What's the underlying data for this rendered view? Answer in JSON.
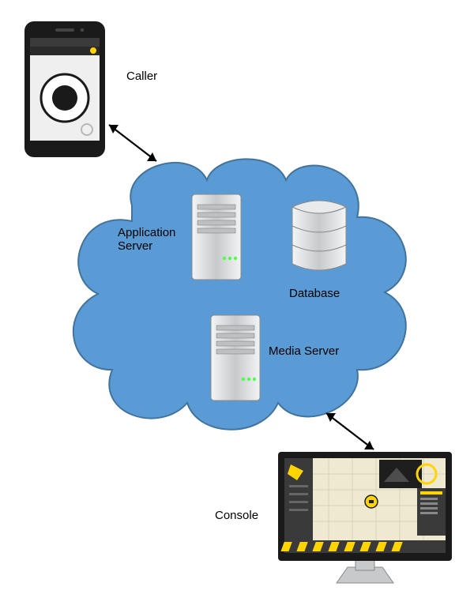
{
  "labels": {
    "caller": "Caller",
    "app_server_line1": "Application",
    "app_server_line2": "Server",
    "database": "Database",
    "media_server": "Media Server",
    "console": "Console"
  },
  "nodes": {
    "phone": "mobile-handset",
    "cloud": "cloud-background",
    "app_server": "tower-server",
    "media_server": "tower-server",
    "database": "database-cylinder",
    "console": "monitor-workstation"
  },
  "colors": {
    "cloud_fill": "#5b9bd5",
    "cloud_stroke": "#41739c",
    "server_body": "#d5d7d9",
    "device_outline": "#1a1a1a",
    "db_fill": "#dcdddf",
    "db_stroke": "#888888"
  }
}
